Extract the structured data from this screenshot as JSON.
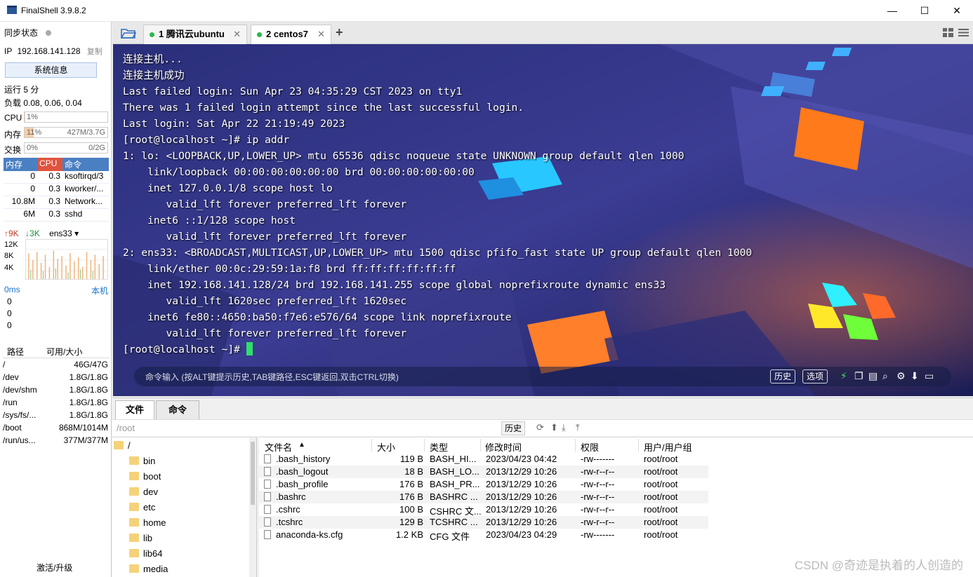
{
  "window": {
    "title": "FinalShell 3.9.8.2",
    "minimize": "—",
    "maximize": "☐",
    "close": "✕"
  },
  "left": {
    "sync_label": "同步状态",
    "ip_label": "IP",
    "ip": "192.168.141.128",
    "copy": "复制",
    "sysinfo": "系统信息",
    "uptime": "运行 5 分",
    "load": "负载 0.08, 0.06, 0.04",
    "cpu_label": "CPU",
    "cpu_value": "1%",
    "cpu_fraction": 0.01,
    "mem_label": "内存",
    "mem_percent": "11%",
    "mem_value": "427M/3.7G",
    "mem_fraction": 0.11,
    "swap_label": "交换",
    "swap_percent": "0%",
    "swap_value": "0/2G",
    "swap_fraction": 0,
    "proc_headers": [
      "内存",
      "CPU",
      "命令"
    ],
    "procs": [
      {
        "mem": "0",
        "cpu": "0.3",
        "cmd": "ksoftirqd/3"
      },
      {
        "mem": "0",
        "cpu": "0.3",
        "cmd": "kworker/..."
      },
      {
        "mem": "10.8M",
        "cpu": "0.3",
        "cmd": "Network..."
      },
      {
        "mem": "6M",
        "cpu": "0.3",
        "cmd": "sshd"
      }
    ],
    "net_up": "↑9K",
    "net_down": "↓3K",
    "net_iface": "ens33",
    "net_ticks": [
      "12K",
      "8K",
      "4K"
    ],
    "ping_label": "0ms",
    "ping_host": "本机",
    "ping_values": [
      "0",
      "0",
      "0"
    ],
    "disk_headers": [
      "路径",
      "可用/大小"
    ],
    "disks": [
      {
        "path": "/",
        "size": "46G/47G"
      },
      {
        "path": "/dev",
        "size": "1.8G/1.8G"
      },
      {
        "path": "/dev/shm",
        "size": "1.8G/1.8G"
      },
      {
        "path": "/run",
        "size": "1.8G/1.8G"
      },
      {
        "path": "/sys/fs/...",
        "size": "1.8G/1.8G"
      },
      {
        "path": "/boot",
        "size": "868M/1014M"
      },
      {
        "path": "/run/us...",
        "size": "377M/377M"
      }
    ],
    "activate": "激活/升级"
  },
  "tabs": [
    {
      "label": "1 腾讯云ubuntu"
    },
    {
      "label": "2 centos7"
    }
  ],
  "terminal": {
    "lines": [
      "连接主机...",
      "连接主机成功",
      "Last failed login: Sun Apr 23 04:35:29 CST 2023 on tty1",
      "There was 1 failed login attempt since the last successful login.",
      "Last login: Sat Apr 22 21:19:49 2023",
      "[root@localhost ~]# ip addr",
      "1: lo: <LOOPBACK,UP,LOWER_UP> mtu 65536 qdisc noqueue state UNKNOWN group default qlen 1000",
      "    link/loopback 00:00:00:00:00:00 brd 00:00:00:00:00:00",
      "    inet 127.0.0.1/8 scope host lo",
      "       valid_lft forever preferred_lft forever",
      "    inet6 ::1/128 scope host",
      "       valid_lft forever preferred_lft forever",
      "2: ens33: <BROADCAST,MULTICAST,UP,LOWER_UP> mtu 1500 qdisc pfifo_fast state UP group default qlen 1000",
      "    link/ether 00:0c:29:59:1a:f8 brd ff:ff:ff:ff:ff:ff",
      "    inet 192.168.141.128/24 brd 192.168.141.255 scope global noprefixroute dynamic ens33",
      "       valid_lft 1620sec preferred_lft 1620sec",
      "    inet6 fe80::4650:ba50:f7e6:e576/64 scope link noprefixroute",
      "       valid_lft forever preferred_lft forever"
    ],
    "prompt": "[root@localhost ~]# ",
    "input_placeholder": "命令输入 (按ALT键提示历史,TAB键路径,ESC键返回,双击CTRL切换)",
    "history_btn": "历史",
    "options_btn": "选项"
  },
  "bottom": {
    "tab_files": "文件",
    "tab_commands": "命令",
    "path": "/root",
    "history_btn": "历史",
    "tree": [
      {
        "name": "/"
      },
      {
        "name": "bin"
      },
      {
        "name": "boot"
      },
      {
        "name": "dev"
      },
      {
        "name": "etc"
      },
      {
        "name": "home"
      },
      {
        "name": "lib"
      },
      {
        "name": "lib64"
      },
      {
        "name": "media"
      }
    ],
    "file_headers": [
      "文件名",
      "大小",
      "类型",
      "修改时间",
      "权限",
      "用户/用户组"
    ],
    "files": [
      {
        "name": ".bash_history",
        "size": "119 B",
        "type": "BASH_HI...",
        "mtime": "2023/04/23 04:42",
        "perm": "-rw-------",
        "owner": "root/root"
      },
      {
        "name": ".bash_logout",
        "size": "18 B",
        "type": "BASH_LO...",
        "mtime": "2013/12/29 10:26",
        "perm": "-rw-r--r--",
        "owner": "root/root"
      },
      {
        "name": ".bash_profile",
        "size": "176 B",
        "type": "BASH_PR...",
        "mtime": "2013/12/29 10:26",
        "perm": "-rw-r--r--",
        "owner": "root/root"
      },
      {
        "name": ".bashrc",
        "size": "176 B",
        "type": "BASHRC ...",
        "mtime": "2013/12/29 10:26",
        "perm": "-rw-r--r--",
        "owner": "root/root"
      },
      {
        "name": ".cshrc",
        "size": "100 B",
        "type": "CSHRC 文...",
        "mtime": "2013/12/29 10:26",
        "perm": "-rw-r--r--",
        "owner": "root/root"
      },
      {
        "name": ".tcshrc",
        "size": "129 B",
        "type": "TCSHRC ...",
        "mtime": "2013/12/29 10:26",
        "perm": "-rw-r--r--",
        "owner": "root/root"
      },
      {
        "name": "anaconda-ks.cfg",
        "size": "1.2 KB",
        "type": "CFG 文件",
        "mtime": "2023/04/23 04:29",
        "perm": "-rw-------",
        "owner": "root/root"
      }
    ],
    "watermark": "CSDN @奇迹是执着的人创造的"
  }
}
